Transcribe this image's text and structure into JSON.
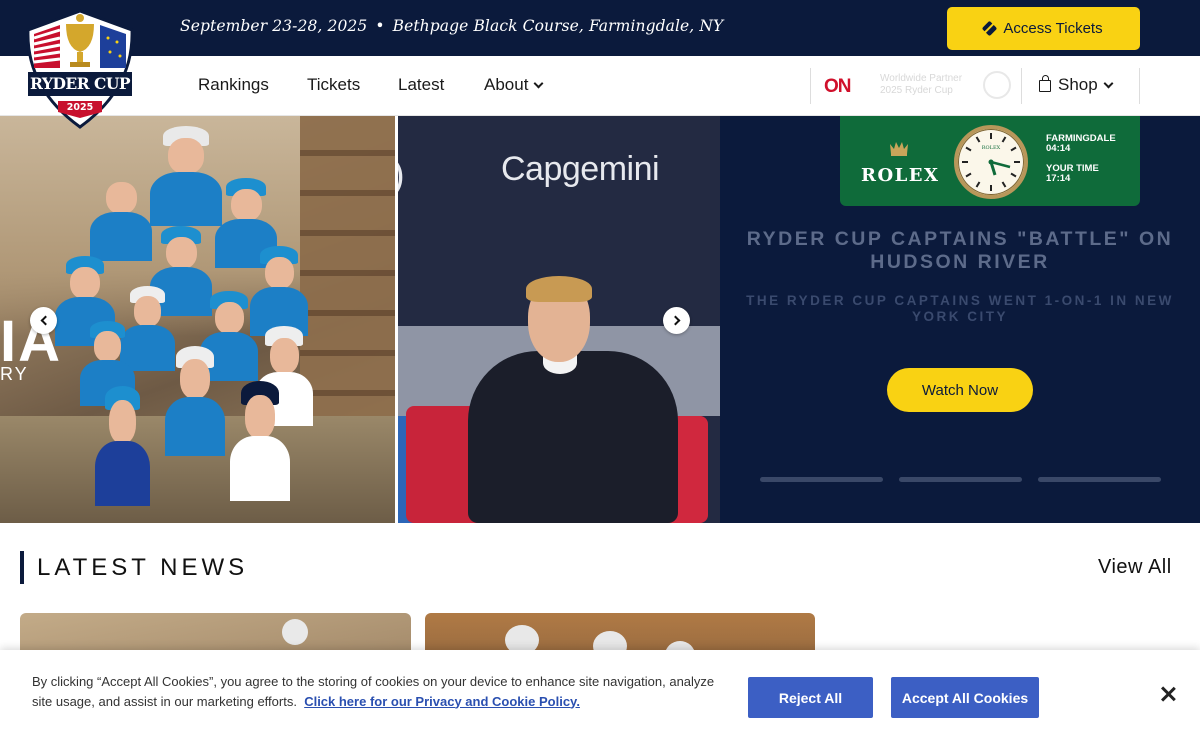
{
  "topbar": {
    "event_date": "September 23-28, 2025",
    "event_venue": "Bethpage Black Course, Farmingdale, NY",
    "separator": "•",
    "tickets_label": "Access Tickets",
    "tickets_icon": "ticket-icon"
  },
  "logo": {
    "line1": "RYDER CUP",
    "year": "2025",
    "icon": "trophy-icon"
  },
  "nav": {
    "items": [
      {
        "label": "Rankings"
      },
      {
        "label": "Tickets"
      },
      {
        "label": "Latest"
      },
      {
        "label": "About"
      }
    ],
    "partner_mark": "ON",
    "partner_line1": "Worldwide Partner",
    "partner_line2": "2025 Ryder Cup",
    "shop_label": "Shop"
  },
  "hero": {
    "slide1_word": "IA",
    "slide1_sub": "RY",
    "slide2_brand": "Capgemini",
    "rolex": {
      "brand": "ROLEX",
      "location_label": "FARMINGDALE",
      "location_time": "04:14",
      "your_label": "YOUR TIME",
      "your_time": "17:14",
      "dial_text": "ROLEX"
    },
    "headline": "RYDER CUP CAPTAINS \"BATTLE\" ON HUDSON RIVER",
    "subheadline": "THE RYDER CUP CAPTAINS WENT 1-ON-1 IN NEW YORK CITY",
    "cta": "Watch Now",
    "slide_count": 3,
    "active_slide": 1
  },
  "news": {
    "heading": "LATEST NEWS",
    "view_all": "View All"
  },
  "cookie": {
    "text": "By clicking “Accept All Cookies”, you agree to the storing of cookies on your device to enhance site navigation, analyze site usage, and assist in our marketing efforts.",
    "link": "Click here for our Privacy and Cookie Policy.",
    "reject": "Reject All",
    "accept": "Accept All Cookies"
  },
  "colors": {
    "navy": "#0b1a3c",
    "yellow": "#f9d213",
    "rolex_green": "#0f6b3a",
    "cookie_blue": "#3c5fc4"
  }
}
